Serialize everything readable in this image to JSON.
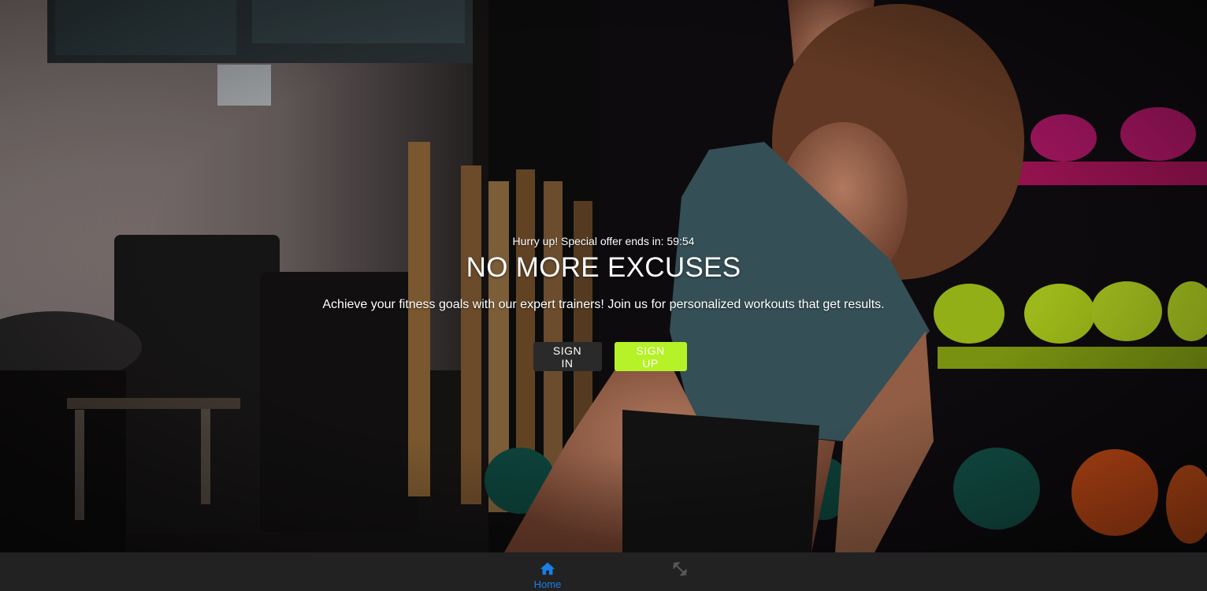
{
  "hero": {
    "countdown_text": "Hurry up! Special offer ends in: 59:54",
    "headline": "NO MORE EXCUSES",
    "subtitle": "Achieve your fitness goals with our expert trainers! Join us for personalized workouts that get results.",
    "signin_label": "SIGN IN",
    "signup_label": "SIGN UP"
  },
  "bottom_nav": {
    "items": [
      {
        "label": "Home",
        "icon": "home-icon",
        "active": true
      },
      {
        "label": "",
        "icon": "dumbbell-icon",
        "active": false
      }
    ]
  },
  "colors": {
    "accent_green": "#b5f227",
    "active_blue": "#1a7fe6",
    "nav_background": "#222222",
    "signin_background": "#2a2a2a"
  }
}
